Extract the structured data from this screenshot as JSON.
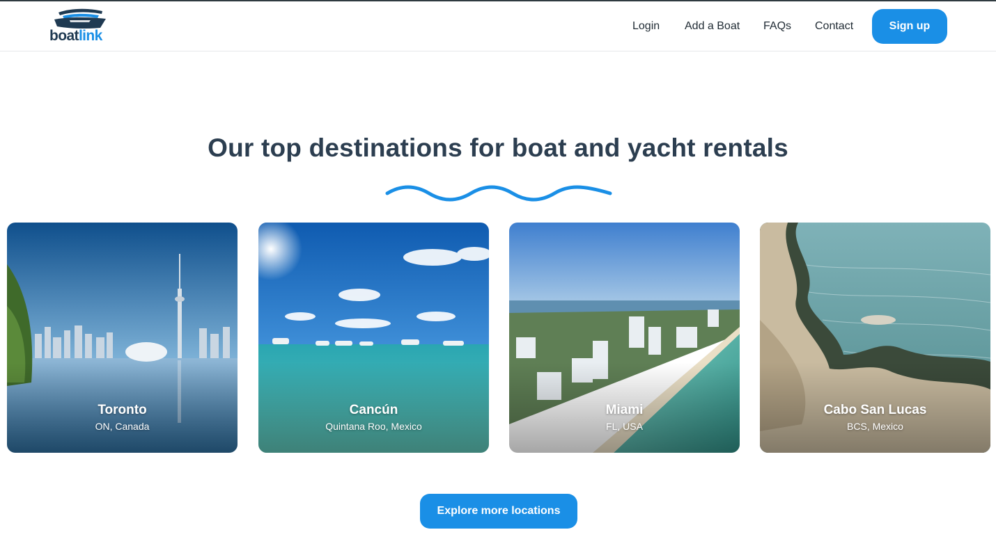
{
  "brand": {
    "logo_part1": "boat",
    "logo_part2": "link",
    "colors": {
      "accent": "#1a8fe6",
      "dark": "#1f3a52",
      "heading": "#2c3e50"
    }
  },
  "nav": {
    "links": [
      "Login",
      "Add a Boat",
      "FAQs",
      "Contact"
    ],
    "signup_label": "Sign up"
  },
  "hero": {
    "title": "Our top destinations for boat and yacht rentals",
    "divider_icon": "wave-icon"
  },
  "destinations": [
    {
      "name": "Toronto",
      "region": "ON, Canada"
    },
    {
      "name": "Cancún",
      "region": "Quintana Roo, Mexico"
    },
    {
      "name": "Miami",
      "region": "FL, USA"
    },
    {
      "name": "Cabo San Lucas",
      "region": "BCS, Mexico"
    }
  ],
  "cta": {
    "explore_label": "Explore more locations"
  }
}
